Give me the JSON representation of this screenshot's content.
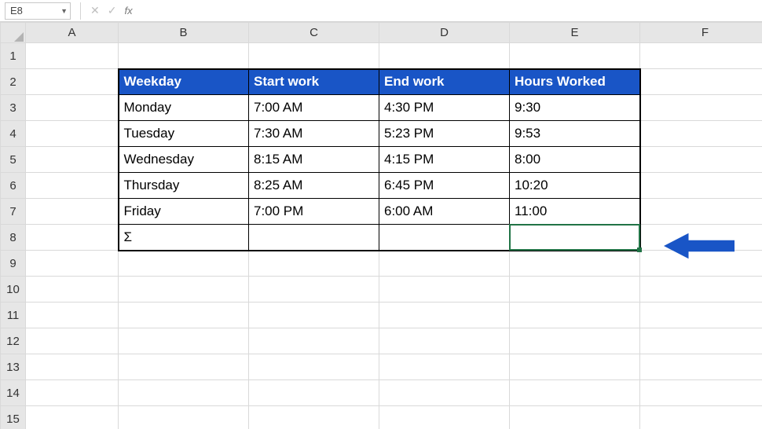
{
  "nameBox": "E8",
  "formulaBar": {
    "fx": "fx",
    "cancel_glyph": "✕",
    "enter_glyph": "✓"
  },
  "formulaValue": "",
  "columns": [
    "A",
    "B",
    "C",
    "D",
    "E",
    "F"
  ],
  "rowCount": 15,
  "table": {
    "header": {
      "b": "Weekday",
      "c": "Start work",
      "d": "End work",
      "e": "Hours Worked"
    },
    "rows": [
      {
        "b": "Monday",
        "c": "7:00 AM",
        "d": "4:30 PM",
        "e": "9:30"
      },
      {
        "b": "Tuesday",
        "c": "7:30 AM",
        "d": "5:23 PM",
        "e": "9:53"
      },
      {
        "b": "Wednesday",
        "c": "8:15 AM",
        "d": "4:15 PM",
        "e": "8:00"
      },
      {
        "b": "Thursday",
        "c": "8:25 AM",
        "d": "6:45 PM",
        "e": "10:20"
      },
      {
        "b": "Friday",
        "c": "7:00 PM",
        "d": "6:00 AM",
        "e": "11:00"
      }
    ],
    "sumLabel": "Σ"
  },
  "chart_data": {
    "type": "table",
    "title": "Hours Worked",
    "columns": [
      "Weekday",
      "Start work",
      "End work",
      "Hours Worked"
    ],
    "rows": [
      [
        "Monday",
        "7:00 AM",
        "4:30 PM",
        "9:30"
      ],
      [
        "Tuesday",
        "7:30 AM",
        "5:23 PM",
        "9:53"
      ],
      [
        "Wednesday",
        "8:15 AM",
        "4:15 PM",
        "8:00"
      ],
      [
        "Thursday",
        "8:25 AM",
        "6:45 PM",
        "10:20"
      ],
      [
        "Friday",
        "7:00 PM",
        "6:00 AM",
        "11:00"
      ]
    ]
  }
}
